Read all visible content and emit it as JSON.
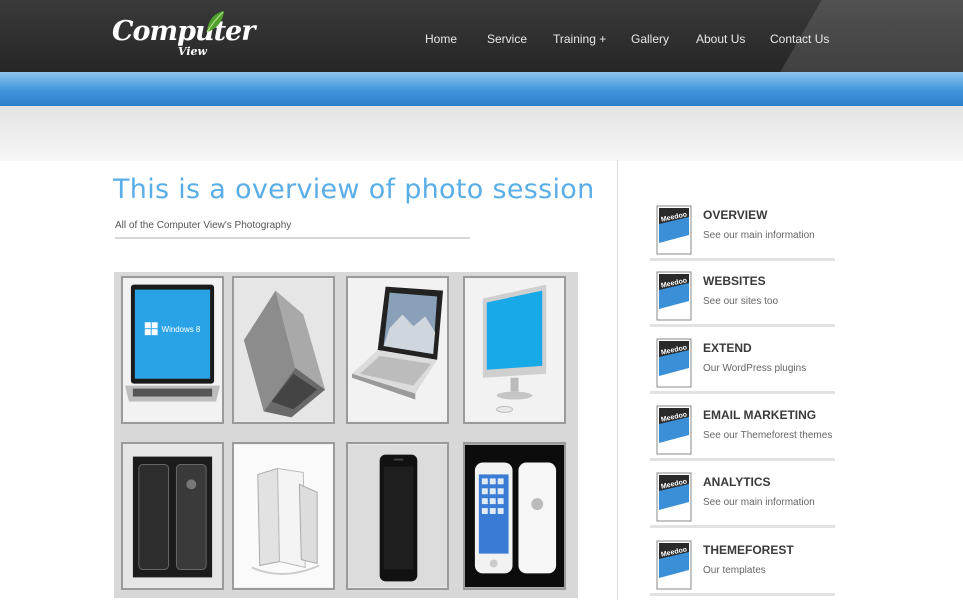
{
  "header": {
    "logo_main": "Computer",
    "logo_sub": "View",
    "nav": [
      {
        "label": "Home"
      },
      {
        "label": "Service"
      },
      {
        "label": "Training +"
      },
      {
        "label": "Gallery"
      },
      {
        "label": "About Us"
      },
      {
        "label": "Contact Us"
      }
    ]
  },
  "main": {
    "title": "This is a overview of photo session",
    "subtitle": "All of the Computer View's Photography",
    "gallery": [
      {
        "icon": "laptop-windows8-image",
        "screen_text": "Windows 8"
      },
      {
        "icon": "laptop-silver-closed-image"
      },
      {
        "icon": "laptop-white-open-image"
      },
      {
        "icon": "desktop-monitor-image"
      },
      {
        "icon": "two-phones-dark-image"
      },
      {
        "icon": "white-phones-image"
      },
      {
        "icon": "black-phone-image"
      },
      {
        "icon": "iphones-front-back-image"
      }
    ]
  },
  "sidebar": {
    "badge_text": "Meedoo",
    "items": [
      {
        "title": "OVERVIEW",
        "desc": "See our main information"
      },
      {
        "title": "WEBSITES",
        "desc": "See our sites too"
      },
      {
        "title": "EXTEND",
        "desc": "Our WordPress plugins"
      },
      {
        "title": "EMAIL MARKETING",
        "desc": "See our Themeforest themes"
      },
      {
        "title": "ANALYTICS",
        "desc": "See our main information"
      },
      {
        "title": "THEMEFOREST",
        "desc": "Our templates"
      }
    ]
  },
  "colors": {
    "accent_blue": "#5aaee8",
    "header_dark": "#2e2e2e",
    "band_blue": "#3f93dc"
  }
}
